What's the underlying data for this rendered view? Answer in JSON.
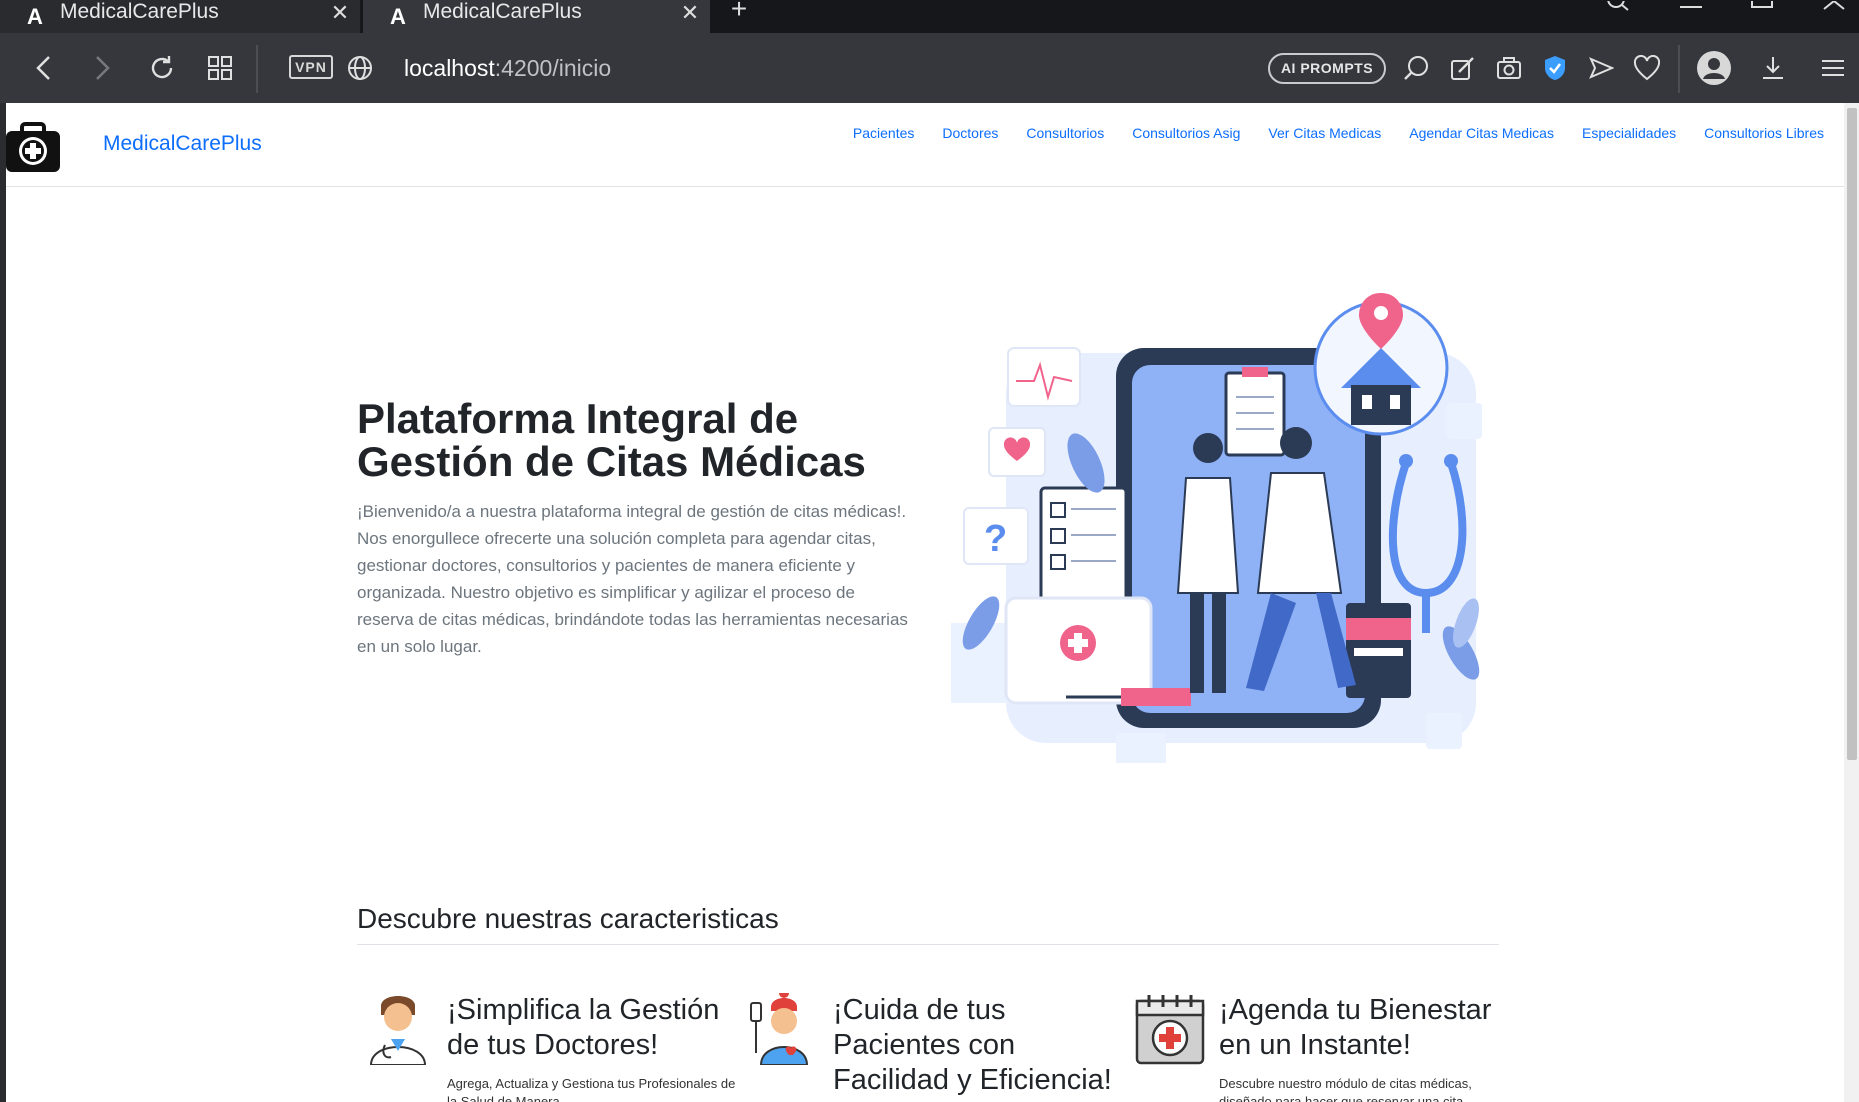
{
  "browser": {
    "tabs": [
      {
        "title": "MedicalCarePlus",
        "active": false
      },
      {
        "title": "MedicalCarePlus",
        "active": true
      }
    ],
    "url_host": "localhost",
    "url_path": ":4200/inicio",
    "vpn_label": "VPN",
    "ai_prompts_label": "AI PROMPTS"
  },
  "navbar": {
    "brand": "MedicalCarePlus",
    "links": [
      "Pacientes",
      "Doctores",
      "Consultorios",
      "Consultorios Asig",
      "Ver Citas Medicas",
      "Agendar Citas Medicas",
      "Especialidades",
      "Consultorios Libres"
    ]
  },
  "hero": {
    "title_line1": "Plataforma Integral de",
    "title_line2": "Gestión de Citas Médicas",
    "description": "¡Bienvenido/a a nuestra plataforma integral de gestión de citas médicas!. Nos enorgullece ofrecerte una solución completa para agendar citas, gestionar doctores, consultorios y pacientes de manera eficiente y organizada. Nuestro objetivo es simplificar y agilizar el proceso de reserva de citas médicas, brindándote todas las herramientas necesarias en un solo lugar."
  },
  "features": {
    "section_title": "Descubre nuestras caracteristicas",
    "items": [
      {
        "title": "¡Simplifica la Gestión de tus Doctores!",
        "text": "Agrega, Actualiza y Gestiona tus Profesionales de la Salud de Manera"
      },
      {
        "title": "¡Cuida de tus Pacientes con Facilidad y Eficiencia!",
        "text": ""
      },
      {
        "title": "¡Agenda tu Bienestar en un Instante!",
        "text": "Descubre nuestro módulo de citas médicas, diseñado para hacer que reservar una cita"
      }
    ]
  },
  "colors": {
    "link_blue": "#0d6efd",
    "heading": "#212529",
    "muted_text": "#6c757d",
    "illustration_blue": "#5b8def",
    "accent_pink": "#f0648c"
  }
}
